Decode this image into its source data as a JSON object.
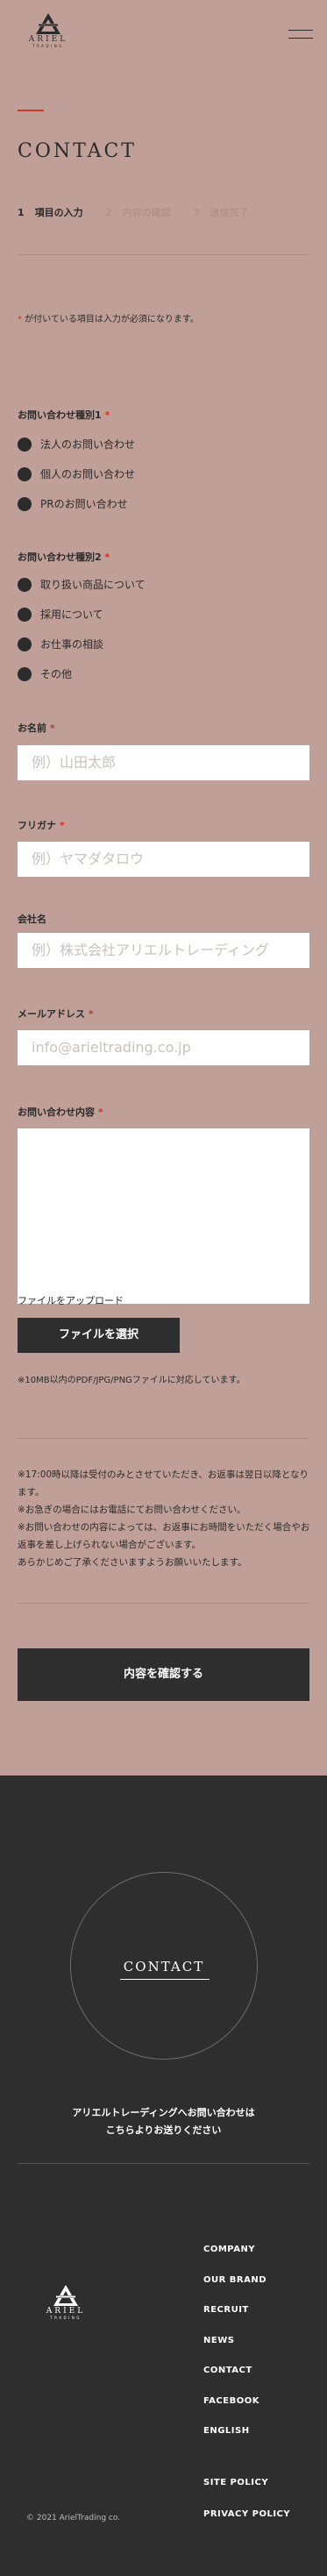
{
  "header": {
    "logo_word": "ARIEL",
    "logo_sub": "TRADING"
  },
  "page_title": "CONTACT",
  "steps": [
    {
      "num": "1",
      "label": "項目の入力"
    },
    {
      "num": "2",
      "label": "内容の確認"
    },
    {
      "num": "3",
      "label": "送信完了"
    }
  ],
  "required_note": {
    "star": "*",
    "text": " が付いている項目は入力が必須になります。"
  },
  "inquiry_type1": {
    "label": "お問い合わせ種別1",
    "star": "*",
    "options": [
      "法人のお問い合わせ",
      "個人のお問い合わせ",
      "PRのお問い合わせ"
    ]
  },
  "inquiry_type2": {
    "label": "お問い合わせ種別2",
    "star": "*",
    "options": [
      "取り扱い商品について",
      "採用について",
      "お仕事の相談",
      "その他"
    ]
  },
  "name": {
    "label": "お名前",
    "star": "*",
    "placeholder": "例）山田太郎"
  },
  "furigana": {
    "label": "フリガナ",
    "star": "*",
    "placeholder": "例）ヤマダタロウ"
  },
  "company": {
    "label": "会社名",
    "placeholder": "例）株式会社アリエルトレーディング"
  },
  "email": {
    "label": "メールアドレス",
    "star": "*",
    "placeholder": "info@arieltrading.co.jp"
  },
  "message": {
    "label": "お問い合わせ内容",
    "star": "*"
  },
  "file": {
    "label": "ファイルをアップロード",
    "button": "ファイルを選択",
    "note": "※10MB以内のPDF/JPG/PNGファイルに対応しています。"
  },
  "notes": [
    "※17:00時以降は受付のみとさせていただき、お返事は翌日以降となります。",
    "※お急ぎの場合にはお電話にてお問い合わせください。",
    "※お問い合わせの内容によっては、お返事にお時間をいただく場合やお返事を差し上げられない場合がございます。",
    "あらかじめご了承くださいますようお願いいたします。"
  ],
  "confirm_button": "内容を確認する",
  "footer": {
    "circle_title": "CONTACT",
    "cta_line1": "アリエルトレーディングへお問い合わせは",
    "cta_line2": "こちらよりお送りください",
    "logo_word": "ARIEL",
    "logo_sub": "TRADING",
    "nav": [
      "COMPANY",
      "OUR BRAND",
      "RECRUIT",
      "NEWS",
      "CONTACT",
      "FACEBOOK",
      "ENGLISH",
      "SITE POLICY",
      "PRIVACY POLICY"
    ],
    "copyright": "© 2021 ArielTrading co."
  },
  "colors": {
    "background": "#bf9f97",
    "dark": "#2e2e2e",
    "accent": "#c0392b"
  }
}
